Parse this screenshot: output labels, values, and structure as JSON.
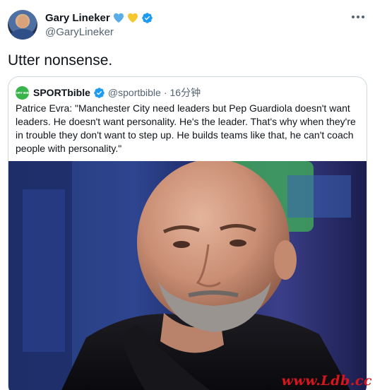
{
  "tweet": {
    "author": {
      "display_name": "Gary Lineker",
      "handle": "@GaryLineker",
      "emoji": [
        "blue-heart",
        "yellow-heart"
      ],
      "verified": true
    },
    "text": "Utter nonsense.",
    "more_icon": "more-dots-icon"
  },
  "quoted": {
    "display_name": "SPORTbible",
    "logo_text": "SPORT BIBLE",
    "handle": "@sportbible",
    "separator": "·",
    "time": "16分钟",
    "verified": true,
    "text": "Patrice Evra: \"Manchester City need leaders but Pep Guardiola doesn't want leaders. He doesn't want personality. He's the leader. That's why when they're in trouble they don't want to step up. He builds teams like that, he can't coach people with personality.\"",
    "photo_icon": "photo-image"
  },
  "watermark": "www.Ldb.cc",
  "colors": {
    "verified": "#1d9bf0",
    "blue_heart": "#5aaee8",
    "yellow_heart": "#f5c832",
    "brand_green": "#36b34a",
    "watermark": "#d8141c"
  }
}
